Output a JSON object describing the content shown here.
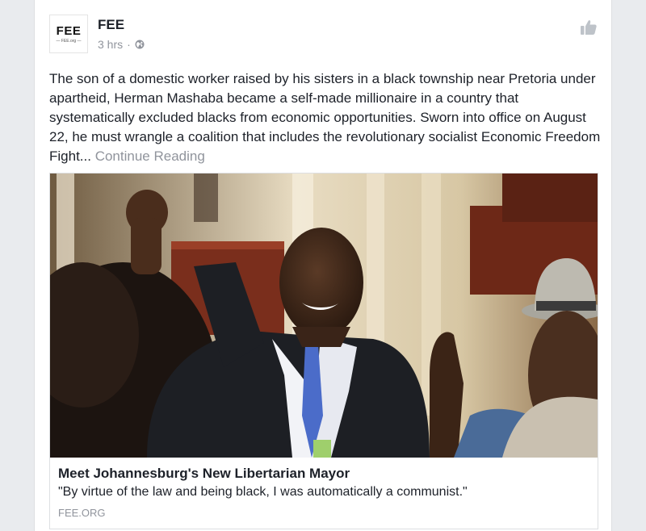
{
  "post": {
    "page_name": "FEE",
    "logo_text": "FEE",
    "logo_subtext": "— FEE.org —",
    "timestamp": "3 hrs",
    "separator": "·",
    "privacy_icon": "globe-icon",
    "body_text": "The son of a domestic worker raised by his sisters in a black township near Pretoria under apartheid, Herman Mashaba became a self-made millionaire in a country that systematically excluded blacks from economic opportunities. Sworn into office on August 22, he must wrangle a coalition that includes the revolutionary socialist Economic Freedom Fight...",
    "continue_label": "Continue Reading"
  },
  "link_preview": {
    "image_alt": "Herman Mashaba raising his fist in a crowded hall",
    "title": "Meet Johannesburg's New Libertarian Mayor",
    "description": "\"By virtue of the law and being black, I was automatically a communist.\"",
    "domain": "FEE.ORG"
  },
  "actions": {
    "like_icon": "thumbs-up-icon"
  },
  "colors": {
    "text": "#1d2129",
    "muted": "#90949c",
    "background": "#e9ebee",
    "card": "#ffffff"
  }
}
